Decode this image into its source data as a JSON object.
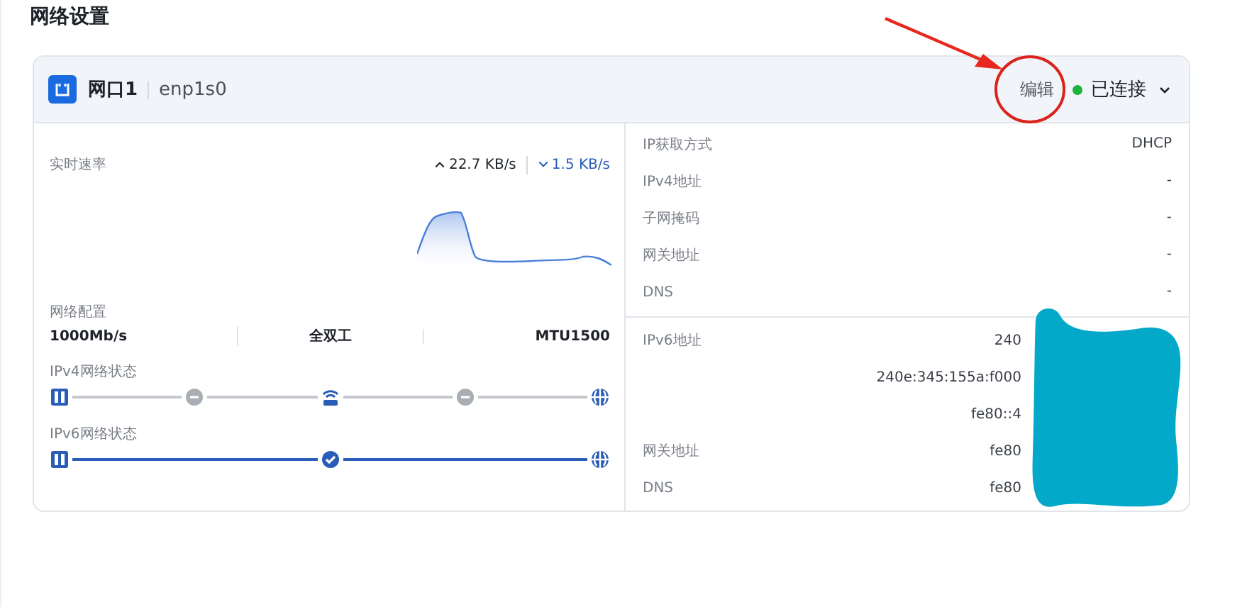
{
  "page_title": "网络设置",
  "interface": {
    "name": "网口1",
    "device": "enp1s0",
    "edit_label": "编辑",
    "status": {
      "label": "已连接",
      "connected": true
    },
    "expanded": false
  },
  "speed": {
    "label": "实时速率",
    "upload": "22.7 KB/s",
    "download": "1.5 KB/s"
  },
  "config": {
    "label": "网络配置",
    "items": [
      "1000Mb/s",
      "全双工",
      "MTU1500"
    ]
  },
  "paths": [
    {
      "label": "IPv4网络状态",
      "links": [
        {
          "kind": "pending"
        },
        {
          "kind": "pending"
        }
      ]
    },
    {
      "label": "IPv6网络状态",
      "links": [
        {
          "kind": "ok"
        }
      ]
    }
  ],
  "ipv4_info": [
    {
      "label": "IP获取方式",
      "values": [
        "DHCP"
      ]
    },
    {
      "label": "IPv4地址",
      "values": [
        "-"
      ]
    },
    {
      "label": "子网掩码",
      "values": [
        "-"
      ]
    },
    {
      "label": "网关地址",
      "values": [
        "-"
      ]
    },
    {
      "label": "DNS",
      "values": [
        "-"
      ]
    }
  ],
  "ipv6_info": [
    {
      "label": "IPv6地址",
      "values": [
        "240",
        "240e:345:155a:f000",
        "fe80::4"
      ]
    },
    {
      "label": "网关地址",
      "values": [
        "fe80"
      ]
    },
    {
      "label": "DNS",
      "values": [
        "fe80"
      ]
    }
  ],
  "annotations": {
    "arrow": true,
    "circle": true,
    "redaction": true
  }
}
